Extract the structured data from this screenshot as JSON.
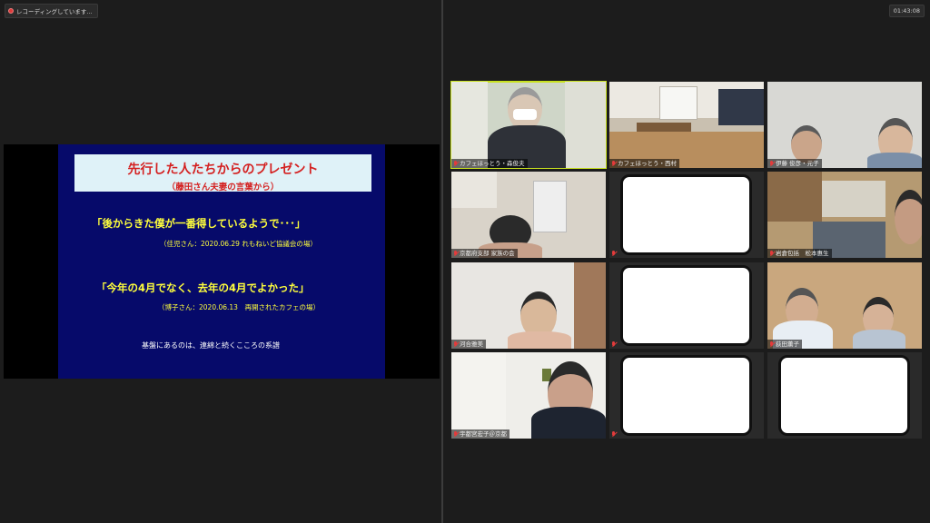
{
  "recording": {
    "label": "レコーディングしています..."
  },
  "timer": {
    "value": "01:43:08"
  },
  "slide": {
    "title": "先行した人たちからのプレゼント",
    "subtitle": "（藤田さん夫妻の言葉から）",
    "quote1": "「後からきた僕が一番得しているようで･･･」",
    "source1": "（佳児さん：2020.06.29 れもねいど協議会の場）",
    "quote2": "「今年の4月でなく、去年の4月でよかった」",
    "source2": "（博子さん：2020.06.13　再開されたカフェの場）",
    "footer": "基盤にあるのは、連綿と続くこころの系譜"
  },
  "participants": [
    {
      "name": "カフェほっとう・森俊夫",
      "active": true
    },
    {
      "name": "カフェほっとう・西村"
    },
    {
      "name": "伊藤 俊彦・元子"
    },
    {
      "name": "京都府支部 家族の会"
    },
    {
      "name": ""
    },
    {
      "name": "岩倉包括　松本惠生"
    },
    {
      "name": "河合雅美"
    },
    {
      "name": ""
    },
    {
      "name": "荻田薫子"
    },
    {
      "name": "宇都宮宏子＠京都"
    },
    {
      "name": ""
    },
    {
      "name": ""
    }
  ],
  "colors": {
    "active_border": "#c9e21f",
    "slide_bg": "#060a6a",
    "quote_yellow": "#ffff3c",
    "title_red": "#d42020"
  }
}
